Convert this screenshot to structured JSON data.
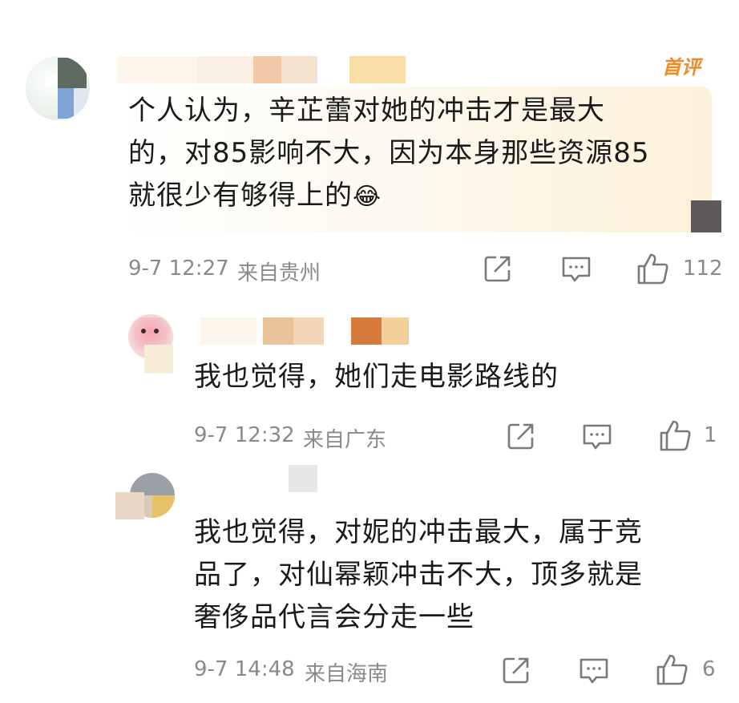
{
  "comments": [
    {
      "badge": "首评",
      "text": "个人认为，辛芷蕾对她的冲击才是最大的，对85影响不大，因为本身那些资源85就很少有够得上的",
      "lines": [
        "个人认为，辛芷蕾对她的冲击才是最大",
        "的，对85影响不大，因为本身那些资源85",
        "就很少有够得上的"
      ],
      "emoji": "😂",
      "time": "9-7 12:27",
      "location": "来自贵州",
      "likes": "112"
    },
    {
      "text": "我也觉得，她们走电影路线的",
      "lines": [
        "我也觉得，她们走电影路线的"
      ],
      "time": "9-7 12:32",
      "location": "来自广东",
      "likes": "1"
    },
    {
      "text": "我也觉得，对妮的冲击最大，属于竞品了，对仙幂颖冲击不大，顶多就是奢侈品代言会分走一些",
      "lines": [
        "我也觉得，对妮的冲击最大，属于竞",
        "品了，对仙幂颖冲击不大，顶多就是",
        "奢侈品代言会分走一些"
      ],
      "time": "9-7 14:48",
      "location": "来自海南",
      "likes": "6"
    }
  ],
  "icons": {
    "share": "share-icon",
    "reply": "comment-icon",
    "like": "thumbs-up-icon"
  },
  "colors": {
    "badge": "#f08a2a",
    "meta": "#8a8a8a",
    "text": "#1a1a1a"
  }
}
